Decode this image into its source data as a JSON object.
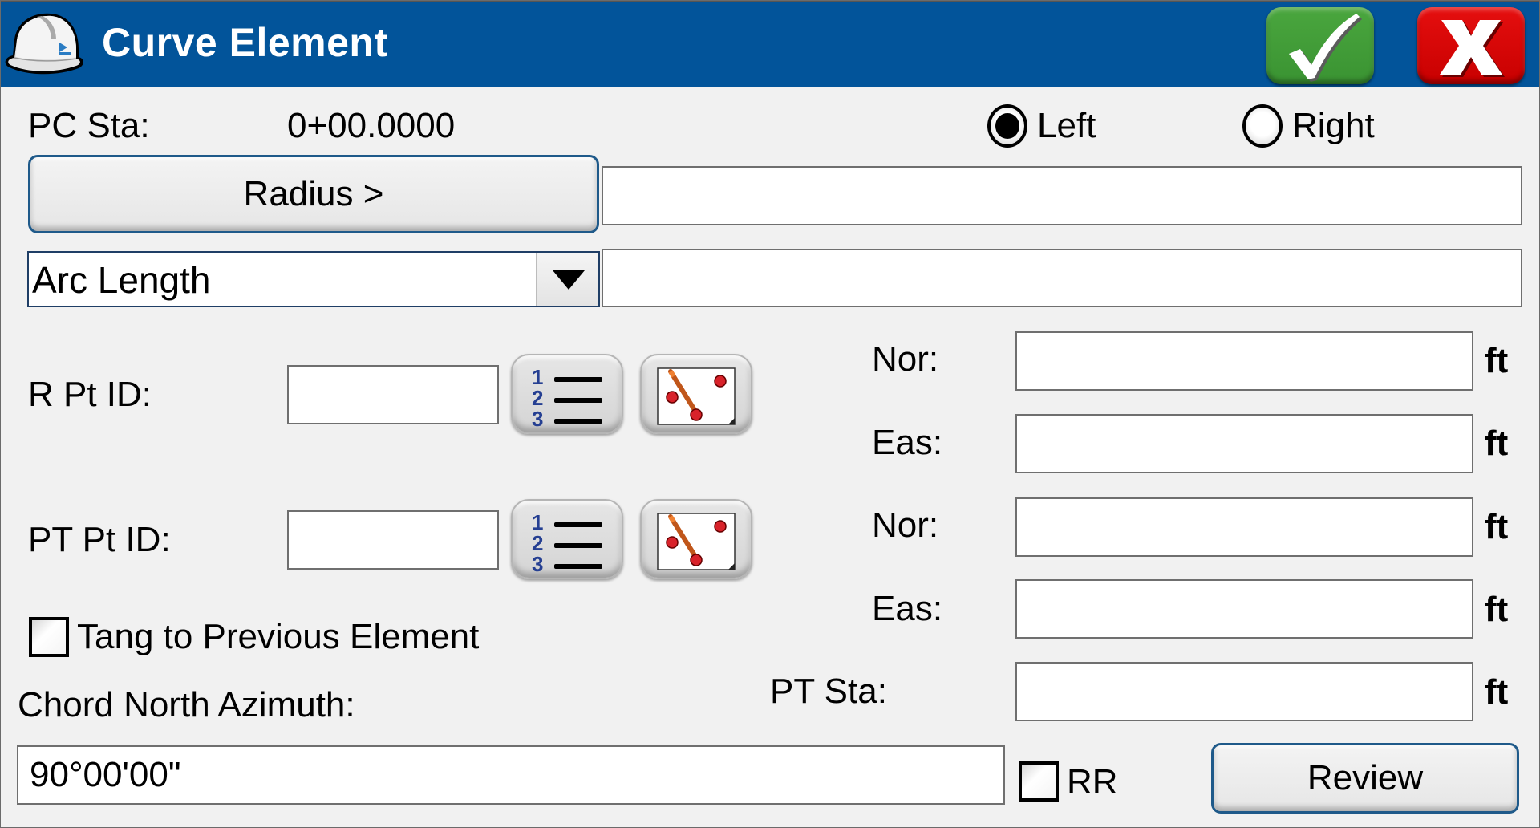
{
  "window": {
    "title": "Curve Element",
    "app_icon": "hard-hat-icon",
    "ok_icon": "checkmark-icon",
    "cancel_icon": "x-close-icon",
    "colors": {
      "title_bar": "#02549a",
      "ok": "#3f9a35",
      "cancel": "#d40000",
      "background": "#f1f1f1"
    }
  },
  "pc_station": {
    "label": "PC Sta:",
    "value": "0+00.0000"
  },
  "direction": {
    "options": [
      {
        "label": "Left",
        "checked": true
      },
      {
        "label": "Right",
        "checked": false
      }
    ]
  },
  "radius": {
    "button_label": "Radius >",
    "value": ""
  },
  "curve_param": {
    "selected": "Arc Length",
    "value": ""
  },
  "r_point": {
    "label": "R Pt ID:",
    "value": "",
    "list_icon": "numbered-list-icon",
    "map_icon": "map-pick-icon",
    "northing": {
      "label": "Nor:",
      "value": "",
      "unit": "ft"
    },
    "easting": {
      "label": "Eas:",
      "value": "",
      "unit": "ft"
    }
  },
  "pt_point": {
    "label": "PT Pt ID:",
    "value": "",
    "list_icon": "numbered-list-icon",
    "map_icon": "map-pick-icon",
    "northing": {
      "label": "Nor:",
      "value": "",
      "unit": "ft"
    },
    "easting": {
      "label": "Eas:",
      "value": "",
      "unit": "ft"
    }
  },
  "tangent_checkbox": {
    "label": "Tang to Previous Element",
    "checked": false
  },
  "pt_station": {
    "label": "PT Sta:",
    "value": "",
    "unit": "ft"
  },
  "chord_azimuth": {
    "label": "Chord North Azimuth:",
    "value": "90°00'00\""
  },
  "rr_checkbox": {
    "label": "RR",
    "checked": false
  },
  "review_button": {
    "label": "Review"
  }
}
